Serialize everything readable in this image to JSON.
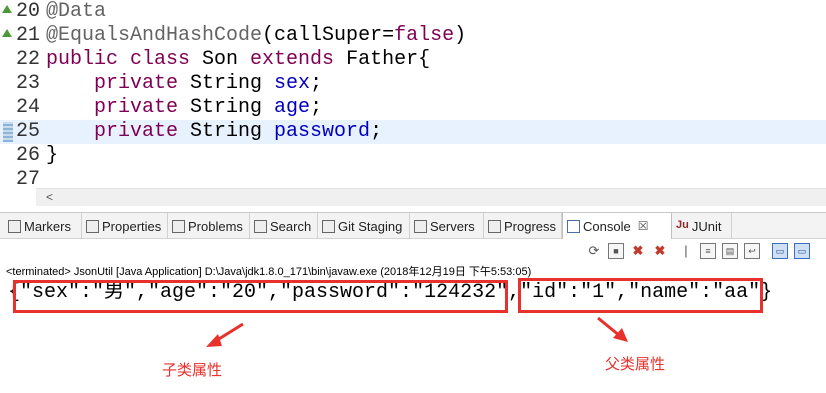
{
  "editor": {
    "lines": [
      {
        "num": "20",
        "parts": [
          {
            "cls": "anno",
            "text": "@Data"
          }
        ]
      },
      {
        "num": "21",
        "parts": [
          {
            "cls": "anno",
            "text": "@EqualsAndHashCode"
          },
          {
            "cls": "",
            "text": "(callSuper="
          },
          {
            "cls": "kwfalse",
            "text": "false"
          },
          {
            "cls": "",
            "text": ")"
          }
        ]
      },
      {
        "num": "22",
        "parts": [
          {
            "cls": "kw",
            "text": "public class"
          },
          {
            "cls": "",
            "text": " Son "
          },
          {
            "cls": "kw",
            "text": "extends"
          },
          {
            "cls": "",
            "text": " Father{"
          }
        ]
      },
      {
        "num": "23",
        "parts": [
          {
            "cls": "",
            "text": "    "
          },
          {
            "cls": "kw",
            "text": "private"
          },
          {
            "cls": "",
            "text": " String "
          },
          {
            "cls": "field",
            "text": "sex"
          },
          {
            "cls": "",
            "text": ";"
          }
        ]
      },
      {
        "num": "24",
        "parts": [
          {
            "cls": "",
            "text": "    "
          },
          {
            "cls": "kw",
            "text": "private"
          },
          {
            "cls": "",
            "text": " String "
          },
          {
            "cls": "field",
            "text": "age"
          },
          {
            "cls": "",
            "text": ";"
          }
        ]
      },
      {
        "num": "25",
        "parts": [
          {
            "cls": "",
            "text": "    "
          },
          {
            "cls": "kw",
            "text": "private"
          },
          {
            "cls": "",
            "text": " String "
          },
          {
            "cls": "field",
            "text": "password"
          },
          {
            "cls": "",
            "text": ";"
          }
        ]
      },
      {
        "num": "26",
        "parts": [
          {
            "cls": "",
            "text": "}"
          }
        ]
      },
      {
        "num": "27",
        "parts": []
      }
    ],
    "current_line": "25",
    "scroll_left_glyph": "<"
  },
  "tabs": [
    {
      "label": "Markers",
      "icon": "markers-icon",
      "glyph": ""
    },
    {
      "label": "Properties",
      "icon": "properties-icon",
      "glyph": ""
    },
    {
      "label": "Problems",
      "icon": "problems-icon",
      "glyph": ""
    },
    {
      "label": "Search",
      "icon": "search-icon",
      "glyph": ""
    },
    {
      "label": "Git Staging",
      "icon": "git-staging-icon",
      "glyph": ""
    },
    {
      "label": "Servers",
      "icon": "servers-icon",
      "glyph": ""
    },
    {
      "label": "Progress",
      "icon": "progress-icon",
      "glyph": ""
    },
    {
      "label": "Console",
      "icon": "console-icon",
      "glyph": "",
      "close": "☒"
    },
    {
      "label": "JUnit",
      "icon": "junit-icon",
      "glyph": "Ju"
    }
  ],
  "console": {
    "terminated_line": "<terminated> JsonUtil [Java Application] D:\\Java\\jdk1.8.0_171\\bin\\javaw.exe (2018年12月19日 下午5:53:05)",
    "output": "{\"sex\":\"男\",\"age\":\"20\",\"password\":\"124232\",\"id\":\"1\",\"name\":\"aa\"}"
  },
  "annotations": {
    "child_label": "子类属性",
    "parent_label": "父类属性",
    "color": "#e8302c"
  }
}
